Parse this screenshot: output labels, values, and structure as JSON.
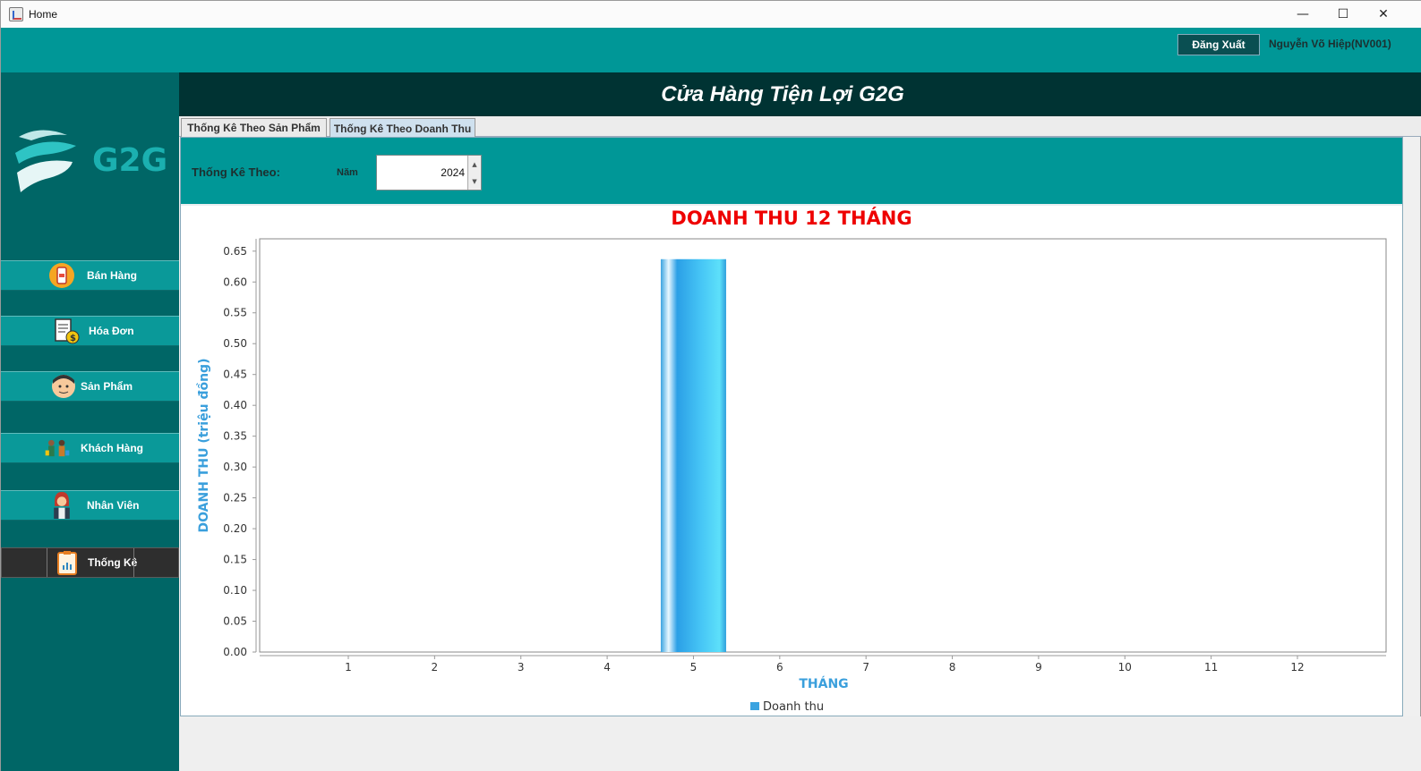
{
  "window": {
    "title": "Home",
    "controls": {
      "minimize": "—",
      "maximize": "☐",
      "close": "✕"
    }
  },
  "header": {
    "logout_label": "Đăng Xuất",
    "user_name": "Nguyễn Võ Hiệp(NV001)"
  },
  "sidebar": {
    "logo_text": "G2G",
    "items": [
      {
        "label": "Bán Hàng",
        "icon": "phone-cart-icon"
      },
      {
        "label": "Hóa Đơn",
        "icon": "invoice-dollar-icon"
      },
      {
        "label": "Sản  Phẩm",
        "icon": "product-face-icon"
      },
      {
        "label": "Khách Hàng",
        "icon": "customers-icon"
      },
      {
        "label": "Nhân Viên",
        "icon": "employee-icon"
      },
      {
        "label": "Thống Kê",
        "icon": "statistics-clipboard-icon",
        "active": true
      }
    ]
  },
  "main": {
    "title": "Cửa Hàng Tiện Lợi G2G",
    "tabs": [
      {
        "label": "Thống Kê Theo Sản Phẩm",
        "selected": false
      },
      {
        "label": "Thống Kê Theo Doanh Thu",
        "selected": true
      }
    ],
    "filter": {
      "label": "Thống Kê Theo:",
      "year_label": "Năm",
      "year_value": "2024"
    }
  },
  "colors": {
    "teal": "#009797",
    "dark_teal": "#006666",
    "header_dark": "#003333",
    "title_red": "#ee0000",
    "axis_blue": "#3a9fdc",
    "bar_blue": "#2fa8e8"
  },
  "chart_data": {
    "type": "bar",
    "title": "DOANH THU 12 THÁNG",
    "xlabel": "THÁNG",
    "ylabel": "DOANH THU (triệu đồng)",
    "categories": [
      "1",
      "2",
      "3",
      "4",
      "5",
      "6",
      "7",
      "8",
      "9",
      "10",
      "11",
      "12"
    ],
    "series": [
      {
        "name": "Doanh thu",
        "values": [
          0,
          0,
          0,
          0,
          0.637,
          0,
          0,
          0,
          0,
          0,
          0,
          0
        ]
      }
    ],
    "ylim": [
      0,
      0.67
    ],
    "yticks": [
      "0.00",
      "0.05",
      "0.10",
      "0.15",
      "0.20",
      "0.25",
      "0.30",
      "0.35",
      "0.40",
      "0.45",
      "0.50",
      "0.55",
      "0.60",
      "0.65"
    ],
    "legend": "bottom-center",
    "grid": false
  }
}
